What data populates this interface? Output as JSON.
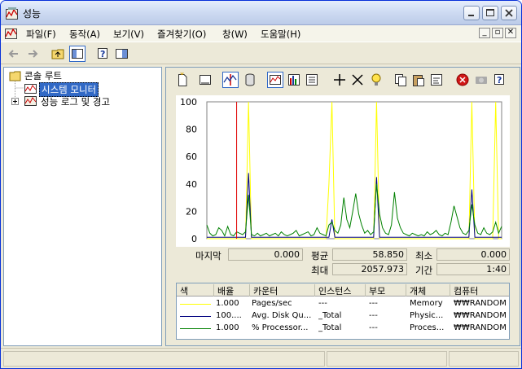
{
  "window": {
    "title": "성능"
  },
  "menu": {
    "items": [
      "파일(F)",
      "동작(A)",
      "보기(V)",
      "즐겨찾기(O)",
      "창(W)",
      "도움말(H)"
    ]
  },
  "tree": {
    "root": "콘솔 루트",
    "items": [
      {
        "label": "시스템 모니터",
        "selected": true
      },
      {
        "label": "성능 로그 및 경고",
        "selected": false
      }
    ]
  },
  "chart_data": {
    "type": "line",
    "ylim": [
      0,
      100
    ],
    "yticks": [
      "100",
      "80",
      "60",
      "40",
      "20",
      "0"
    ],
    "x": [
      0,
      1,
      2,
      3,
      4,
      5,
      6,
      7,
      8,
      9,
      10,
      11,
      12,
      13,
      14,
      15,
      16,
      17,
      18,
      19,
      20,
      21,
      22,
      23,
      24,
      25,
      26,
      27,
      28,
      29,
      30,
      31,
      32,
      33,
      34,
      35,
      36,
      37,
      38,
      39,
      40,
      41,
      42,
      43,
      44,
      45,
      46,
      47,
      48,
      49,
      50,
      51,
      52,
      53,
      54,
      55,
      56,
      57,
      58,
      59,
      60,
      61,
      62,
      63,
      64,
      65,
      66,
      67,
      68,
      69,
      70,
      71,
      72,
      73,
      74,
      75,
      76,
      77,
      78,
      79,
      80,
      81,
      82,
      83,
      84,
      85,
      86,
      87,
      88,
      89,
      90,
      91,
      92,
      93,
      94,
      95,
      96,
      97,
      98,
      99
    ],
    "current_marker_index": 10,
    "series": [
      {
        "name": "Pages/sec",
        "color": "#ffff00",
        "values": [
          0,
          0,
          0,
          0,
          0,
          0,
          0,
          0,
          0,
          0,
          0,
          0,
          0,
          0,
          100,
          0,
          0,
          0,
          0,
          0,
          0,
          0,
          0,
          0,
          0,
          0,
          0,
          0,
          0,
          0,
          0,
          0,
          0,
          0,
          0,
          0,
          0,
          0,
          0,
          0,
          0,
          40,
          100,
          0,
          0,
          0,
          0,
          0,
          0,
          0,
          0,
          0,
          0,
          0,
          0,
          0,
          0,
          100,
          0,
          0,
          0,
          0,
          0,
          0,
          0,
          0,
          0,
          0,
          0,
          0,
          0,
          0,
          0,
          0,
          0,
          0,
          0,
          0,
          0,
          0,
          0,
          0,
          0,
          0,
          0,
          0,
          0,
          0,
          0,
          100,
          0,
          0,
          0,
          0,
          0,
          0,
          0,
          100,
          0,
          0
        ]
      },
      {
        "name": "Avg. Disk Queue Length",
        "color": "#000080",
        "values": [
          1,
          1,
          1,
          1,
          1,
          1,
          1,
          1,
          1,
          1,
          1,
          1,
          1,
          1,
          48,
          1,
          1,
          1,
          1,
          1,
          1,
          1,
          1,
          1,
          1,
          1,
          1,
          1,
          1,
          1,
          1,
          1,
          1,
          1,
          1,
          1,
          1,
          1,
          1,
          1,
          1,
          1,
          14,
          1,
          1,
          1,
          1,
          1,
          1,
          1,
          1,
          1,
          1,
          1,
          1,
          1,
          1,
          45,
          1,
          1,
          1,
          1,
          1,
          1,
          1,
          1,
          1,
          1,
          1,
          1,
          1,
          1,
          1,
          1,
          1,
          1,
          1,
          1,
          1,
          1,
          1,
          1,
          1,
          1,
          1,
          1,
          1,
          1,
          1,
          36,
          1,
          1,
          1,
          1,
          1,
          1,
          1,
          1,
          1,
          1
        ]
      },
      {
        "name": "% Processor Time",
        "color": "#008000",
        "values": [
          10,
          4,
          2,
          3,
          8,
          6,
          2,
          9,
          3,
          2,
          5,
          4,
          3,
          5,
          32,
          3,
          2,
          4,
          2,
          3,
          4,
          2,
          3,
          4,
          2,
          5,
          3,
          2,
          3,
          4,
          6,
          2,
          3,
          4,
          5,
          2,
          3,
          8,
          4,
          3,
          2,
          10,
          12,
          6,
          4,
          10,
          30,
          14,
          8,
          20,
          33,
          18,
          10,
          4,
          6,
          3,
          5,
          40,
          18,
          8,
          4,
          3,
          10,
          34,
          15,
          8,
          4,
          3,
          2,
          4,
          3,
          2,
          3,
          2,
          5,
          3,
          4,
          6,
          3,
          2,
          4,
          3,
          12,
          24,
          16,
          8,
          4,
          3,
          6,
          25,
          10,
          4,
          3,
          8,
          4,
          3,
          5,
          12,
          4,
          9
        ]
      }
    ]
  },
  "stats": {
    "last_label": "마지막",
    "last_value": "0.000",
    "avg_label": "평균",
    "avg_value": "58.850",
    "min_label": "최소",
    "min_value": "0.000",
    "max_label": "최대",
    "max_value": "2057.973",
    "duration_label": "기간",
    "duration_value": "1:40"
  },
  "counters": {
    "headers": [
      "색",
      "배율",
      "카운터",
      "인스턴스",
      "부모",
      "개체",
      "컴퓨터"
    ],
    "rows": [
      {
        "color": "#ffff00",
        "scale": "1.000",
        "counter": "Pages/sec",
        "instance": "---",
        "parent": "---",
        "object": "Memory",
        "computer": "₩₩RANDOM"
      },
      {
        "color": "#000080",
        "scale": "100....",
        "counter": "Avg. Disk Qu...",
        "instance": "_Total",
        "parent": "---",
        "object": "Physic...",
        "computer": "₩₩RANDOM"
      },
      {
        "color": "#008000",
        "scale": "1.000",
        "counter": "% Processor...",
        "instance": "_Total",
        "parent": "---",
        "object": "Proces...",
        "computer": "₩₩RANDOM"
      }
    ]
  }
}
